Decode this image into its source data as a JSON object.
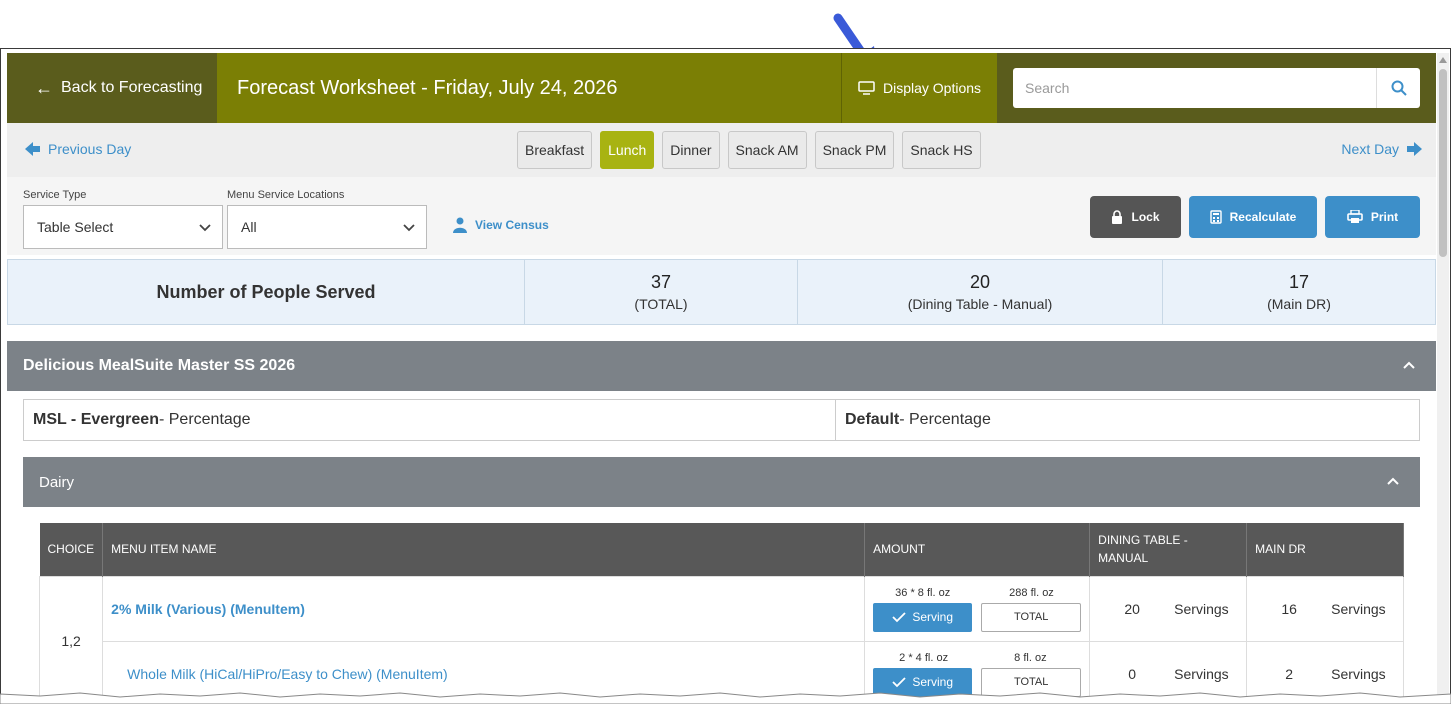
{
  "header": {
    "back_label": "Back to Forecasting",
    "title": "Forecast Worksheet - Friday, July 24, 2026",
    "display_options": "Display Options",
    "search_placeholder": "Search"
  },
  "nav": {
    "prev_day": "Previous Day",
    "next_day": "Next Day",
    "meals": [
      "Breakfast",
      "Lunch",
      "Dinner",
      "Snack AM",
      "Snack PM",
      "Snack HS"
    ],
    "active_meal": "Lunch"
  },
  "filters": {
    "service_type_label": "Service Type",
    "service_type_value": "Table Select",
    "locations_label": "Menu Service Locations",
    "locations_value": "All",
    "view_census": "View Census",
    "lock": "Lock",
    "recalculate": "Recalculate",
    "print": "Print"
  },
  "people": {
    "heading": "Number of People Served",
    "stats": [
      {
        "value": "37",
        "label": "(TOTAL)"
      },
      {
        "value": "20",
        "label": "(Dining Table - Manual)"
      },
      {
        "value": "17",
        "label": "(Main DR)"
      }
    ]
  },
  "section": {
    "title": "Delicious MealSuite Master SS 2026",
    "rules": [
      {
        "name": "MSL - Evergreen",
        "type": " - Percentage"
      },
      {
        "name": "Default",
        "type": " - Percentage"
      }
    ],
    "category": "Dairy"
  },
  "table": {
    "headers": [
      "CHOICE",
      "MENU ITEM NAME",
      "AMOUNT",
      "DINING TABLE - MANUAL",
      "MAIN DR"
    ],
    "choice": "1,2",
    "rows": [
      {
        "name": "2% Milk (Various) (MenuItem)",
        "amount": "36 * 8 fl. oz",
        "total": "288 fl. oz",
        "serving_btn": "Serving",
        "total_btn": "TOTAL",
        "dining": "20",
        "dining_unit": "Servings",
        "main": "16",
        "main_unit": "Servings"
      },
      {
        "name": "Whole Milk (HiCal/HiPro/Easy to Chew) (MenuItem)",
        "amount": "2 * 4 fl. oz",
        "total": "8 fl. oz",
        "serving_btn": "Serving",
        "total_btn": "TOTAL",
        "dining": "0",
        "dining_unit": "Servings",
        "main": "2",
        "main_unit": "Servings"
      }
    ]
  },
  "colors": {
    "olive": "#7b7f05",
    "olive_dark": "#5a5c1c",
    "active_meal": "#a8b312",
    "blue": "#3d8fc9",
    "lock": "#555555",
    "section": "#7c8288",
    "table_head": "#585858"
  }
}
